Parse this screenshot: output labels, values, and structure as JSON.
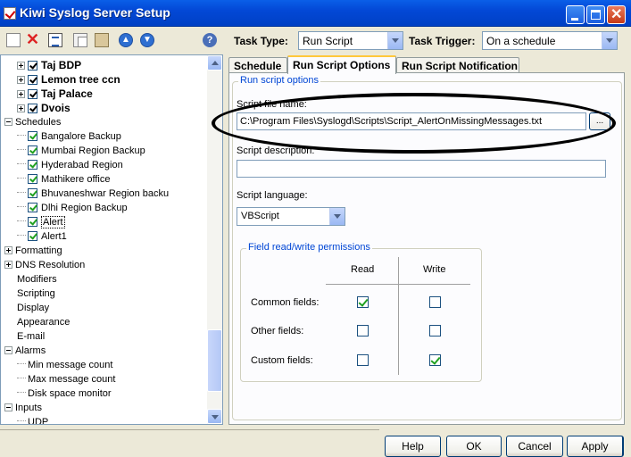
{
  "window": {
    "title": "Kiwi Syslog Server Setup"
  },
  "toolbar": {
    "task_type_label": "Task Type:",
    "task_type_value": "Run Script",
    "task_trigger_label": "Task Trigger:",
    "task_trigger_value": "On a schedule",
    "help_glyph": "?"
  },
  "tree": {
    "items": [
      {
        "label": "Taj BDP",
        "checked": true
      },
      {
        "label": "Lemon tree ccn",
        "checked": true
      },
      {
        "label": "Taj Palace",
        "checked": true
      },
      {
        "label": "Dvois",
        "checked": true
      },
      {
        "label": "Schedules"
      },
      {
        "label": "Bangalore Backup",
        "checked": true
      },
      {
        "label": "Mumbai Region Backup",
        "checked": true
      },
      {
        "label": "Hyderabad Region",
        "checked": true
      },
      {
        "label": "Mathikere office",
        "checked": true
      },
      {
        "label": "Bhuvaneshwar Region backu",
        "checked": true
      },
      {
        "label": "Dlhi Region Backup",
        "checked": true
      },
      {
        "label": "Alert",
        "checked": true
      },
      {
        "label": "Alert1",
        "checked": true
      },
      {
        "label": "Formatting"
      },
      {
        "label": "DNS Resolution"
      },
      {
        "label": "Modifiers"
      },
      {
        "label": "Scripting"
      },
      {
        "label": "Display"
      },
      {
        "label": "Appearance"
      },
      {
        "label": "E-mail"
      },
      {
        "label": "Alarms"
      },
      {
        "label": "Min message count"
      },
      {
        "label": "Max message count"
      },
      {
        "label": "Disk space monitor"
      },
      {
        "label": "Inputs"
      },
      {
        "label": "UDP"
      }
    ]
  },
  "tabs": [
    {
      "label": "Schedule"
    },
    {
      "label": "Run Script Options",
      "active": true
    },
    {
      "label": "Run Script Notification"
    }
  ],
  "run_script_options": {
    "group_title": "Run script options",
    "script_file_label": "Script file name:",
    "script_file_value": "C:\\Program Files\\Syslogd\\Scripts\\Script_AlertOnMissingMessages.txt",
    "browse_label": "...",
    "script_description_label": "Script description:",
    "script_description_value": "",
    "script_language_label": "Script language:",
    "script_language_value": "VBScript",
    "permissions": {
      "title": "Field read/write permissions",
      "read_header": "Read",
      "write_header": "Write",
      "rows": [
        {
          "label": "Common fields:",
          "read": true,
          "write": false
        },
        {
          "label": "Other fields:",
          "read": false,
          "write": false
        },
        {
          "label": "Custom fields:",
          "read": false,
          "write": true
        }
      ]
    }
  },
  "buttons": {
    "help": "Help",
    "ok": "OK",
    "cancel": "Cancel",
    "apply": "Apply"
  },
  "colors": {
    "titlebar": "#0348d6",
    "tab_highlight": "#ffc83c",
    "group_title": "#0046d5",
    "check": "#21a121"
  }
}
